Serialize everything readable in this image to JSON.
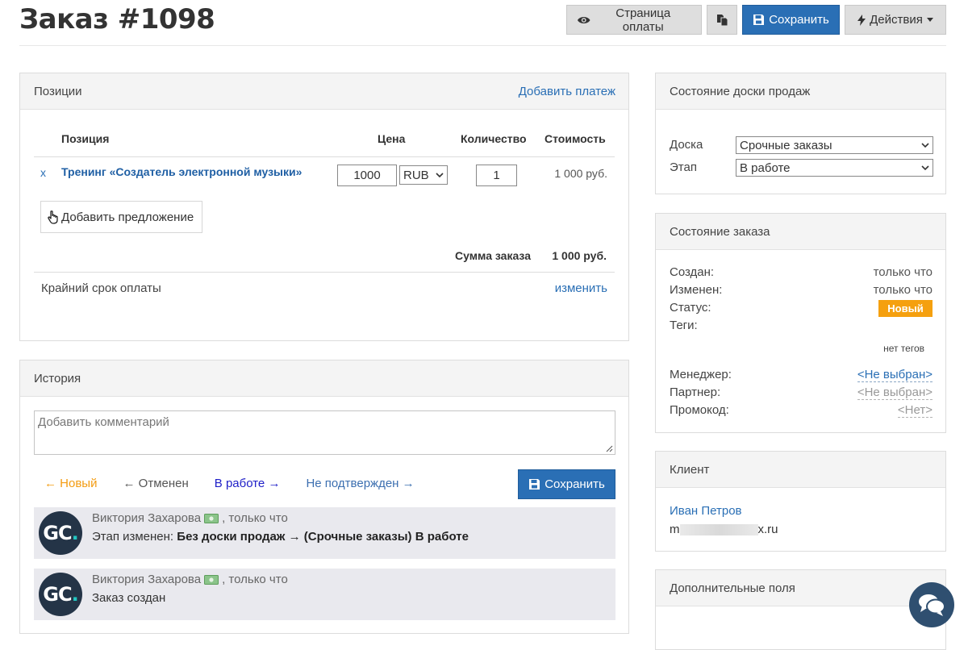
{
  "page": {
    "title": "Заказ #1098"
  },
  "toolbar": {
    "payment_page_label": "Страница оплаты",
    "save_label": "Сохранить",
    "actions_label": "Действия"
  },
  "positions": {
    "title": "Позиции",
    "add_payment": "Добавить платеж",
    "headers": {
      "item": "Позиция",
      "price": "Цена",
      "quantity": "Количество",
      "cost": "Стоимость"
    },
    "rows": [
      {
        "remove": "x",
        "name": "Тренинг «Создатель электронной музыки»",
        "price": "1000",
        "currency": "RUB",
        "quantity": "1",
        "cost": "1 000 руб."
      }
    ],
    "add_offer": "Добавить предложение",
    "sum_label": "Сумма заказа",
    "sum_value": "1 000 руб.",
    "deadline_label": "Крайний срок оплаты",
    "deadline_edit": "изменить"
  },
  "history": {
    "title": "История",
    "comment_placeholder": "Добавить комментарий",
    "status_links": [
      {
        "label": "← Новый",
        "color": "#f39c12"
      },
      {
        "label": "← Отменен",
        "color": "#555555"
      },
      {
        "label": "В работе →",
        "color": "#2020c8"
      },
      {
        "label": "Не подтвержден →",
        "color": "#3c6fb0"
      }
    ],
    "save_label": "Сохранить",
    "entries": [
      {
        "avatar": "GC",
        "author": "Виктория Захарова",
        "time": ", только что",
        "prefix": "Этап изменен: ",
        "text": "Без доски продаж → (Срочные заказы) В работе"
      },
      {
        "avatar": "GC",
        "author": "Виктория Захарова",
        "time": ", только что",
        "prefix": "",
        "text": "Заказ создан"
      }
    ]
  },
  "board": {
    "title": "Состояние доски продаж",
    "board_label": "Доска",
    "board_value": "Срочные заказы",
    "stage_label": "Этап",
    "stage_value": "В работе"
  },
  "order_state": {
    "title": "Состояние заказа",
    "created_label": "Создан:",
    "created_value": "только что",
    "changed_label": "Изменен:",
    "changed_value": "только что",
    "status_label": "Статус:",
    "status_value": "Новый",
    "tags_label": "Теги:",
    "tags_value": "нет тегов",
    "manager_label": "Менеджер:",
    "manager_value": "<Не выбран>",
    "partner_label": "Партнер:",
    "partner_value": "<Не выбран>",
    "promo_label": "Промокод:",
    "promo_value": "<Нет>"
  },
  "client": {
    "title": "Клиент",
    "name": "Иван Петров",
    "email_start": "m",
    "email_end": "x.ru"
  },
  "extra": {
    "title": "Дополнительные поля"
  },
  "colors": {
    "primary": "#2a6fb5",
    "status_new": "#f5a00f",
    "avatar_bg": "#243447",
    "chat_bg": "#2f4f70"
  }
}
